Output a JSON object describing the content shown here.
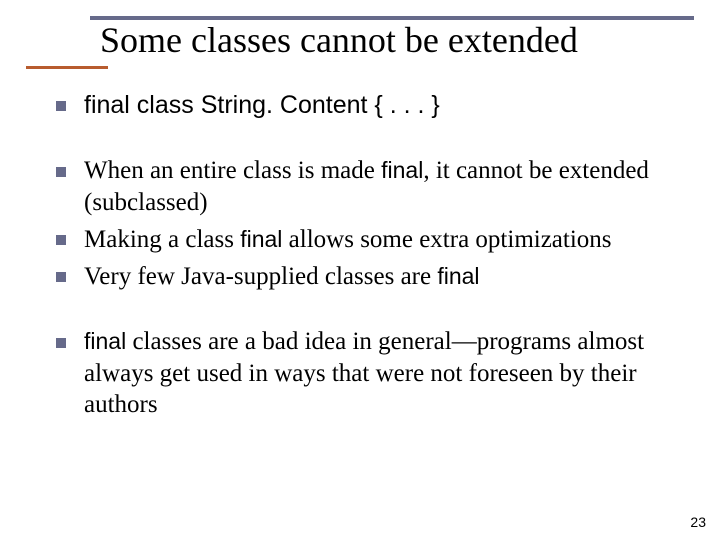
{
  "title": "Some classes cannot be extended",
  "bullets": {
    "g1": [
      {
        "parts": [
          {
            "text": "final class String. Content { . . . }",
            "sans": true
          }
        ]
      }
    ],
    "g2": [
      {
        "parts": [
          {
            "text": "When an entire class is made "
          },
          {
            "text": "final",
            "sans": true
          },
          {
            "text": ", it cannot be extended (subclassed)"
          }
        ]
      },
      {
        "parts": [
          {
            "text": "Making a class "
          },
          {
            "text": "final",
            "sans": true
          },
          {
            "text": " allows some extra optimizations"
          }
        ]
      },
      {
        "parts": [
          {
            "text": "Very few Java-supplied classes are "
          },
          {
            "text": "final",
            "sans": true
          }
        ]
      }
    ],
    "g3": [
      {
        "parts": [
          {
            "text": "final",
            "sans": true
          },
          {
            "text": " classes are a bad idea in general—programs almost always get used in ways that were not foreseen by their authors"
          }
        ]
      }
    ]
  },
  "page_number": "23"
}
